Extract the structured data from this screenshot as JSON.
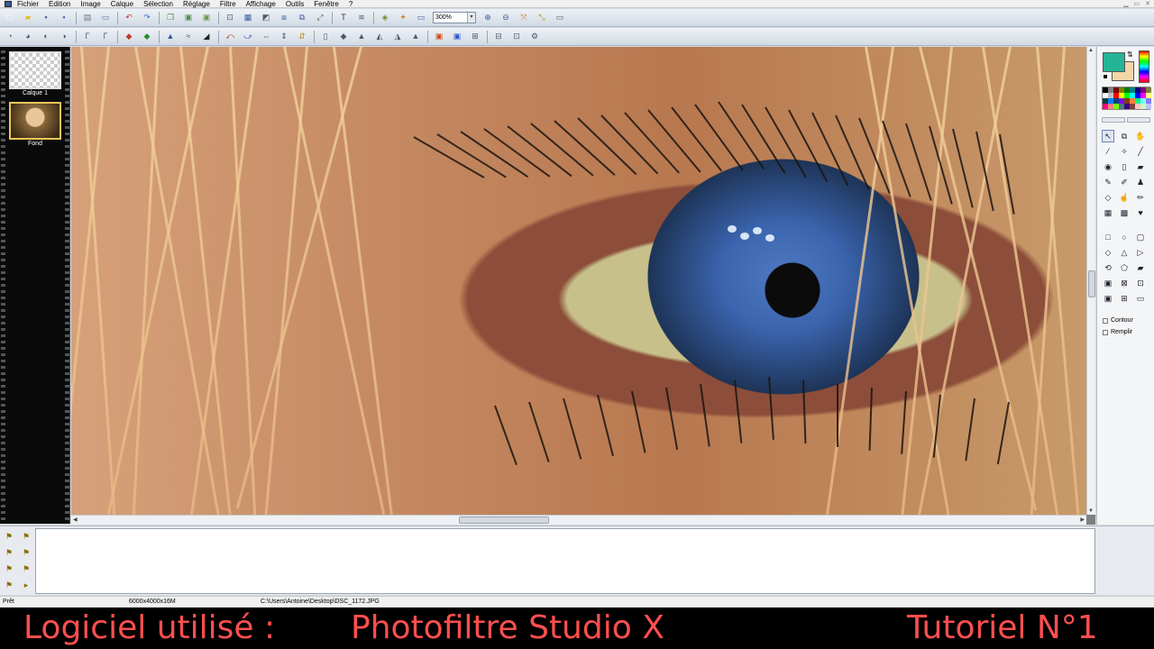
{
  "menubar": {
    "items": [
      "Fichier",
      "Edition",
      "Image",
      "Calque",
      "Sélection",
      "Réglage",
      "Filtre",
      "Affichage",
      "Outils",
      "Fenêtre",
      "?"
    ]
  },
  "toolbar1": {
    "buttons": [
      {
        "icon": "new-file-icon",
        "glyph": "□",
        "color": "#ffffff"
      },
      {
        "icon": "open-folder-icon",
        "glyph": "▰",
        "color": "#e9b93c"
      },
      {
        "icon": "save-icon",
        "glyph": "▪",
        "color": "#3b5f9e"
      },
      {
        "icon": "save-as-icon",
        "glyph": "▪",
        "color": "#4c6fae"
      },
      {
        "icon": "print-icon",
        "glyph": "▤",
        "color": "#6a7480"
      },
      {
        "icon": "scan-icon",
        "glyph": "▭",
        "color": "#5a6fa6"
      },
      {
        "icon": "undo-icon",
        "glyph": "↶",
        "color": "#c0392b"
      },
      {
        "icon": "redo-icon",
        "glyph": "↷",
        "color": "#3a6fc4"
      },
      {
        "icon": "copy-icon",
        "glyph": "❐",
        "color": "#4a8d4a"
      },
      {
        "icon": "paste-icon",
        "glyph": "▣",
        "color": "#4a8d4a"
      },
      {
        "icon": "paste-new-icon",
        "glyph": "▣",
        "color": "#6a9d4a"
      },
      {
        "icon": "crop-icon",
        "glyph": "⊡",
        "color": "#505a66"
      },
      {
        "icon": "select-all-icon",
        "glyph": "▦",
        "color": "#3a5a9e"
      },
      {
        "icon": "invert-selection-icon",
        "glyph": "◩",
        "color": "#505a66"
      },
      {
        "icon": "image-size-icon",
        "glyph": "⧈",
        "color": "#3a5a9e"
      },
      {
        "icon": "canvas-size-icon",
        "glyph": "⧉",
        "color": "#3a5a9e"
      },
      {
        "icon": "transform-icon",
        "glyph": "⤢",
        "color": "#505a66"
      },
      {
        "icon": "text-icon",
        "glyph": "T",
        "color": "#333333"
      },
      {
        "icon": "warp-icon",
        "glyph": "≋",
        "color": "#505a66"
      },
      {
        "icon": "layer-icon",
        "glyph": "◈",
        "color": "#6a8d2a"
      },
      {
        "icon": "effects-icon",
        "glyph": "✦",
        "color": "#d08a1a"
      },
      {
        "icon": "window-icon",
        "glyph": "▭",
        "color": "#3a5a9e"
      }
    ],
    "zoom_value": "300%",
    "zoom_buttons": [
      {
        "icon": "zoom-in-icon",
        "glyph": "⊕",
        "color": "#3a5a9e"
      },
      {
        "icon": "zoom-out-icon",
        "glyph": "⊖",
        "color": "#3a5a9e"
      },
      {
        "icon": "fit-window-icon",
        "glyph": "⤧",
        "color": "#c08a1a"
      },
      {
        "icon": "actual-size-icon",
        "glyph": "⤡",
        "color": "#c08a1a"
      },
      {
        "icon": "fullscreen-icon",
        "glyph": "▭",
        "color": "#505a66"
      }
    ]
  },
  "toolbar2": {
    "buttons": [
      {
        "icon": "auto-level-icon",
        "glyph": "◔",
        "color": "#505a66"
      },
      {
        "icon": "auto-contrast-icon",
        "glyph": "◕",
        "color": "#505a66"
      },
      {
        "icon": "brightness-minus-icon",
        "glyph": "◐",
        "color": "#505a66"
      },
      {
        "icon": "brightness-plus-icon",
        "glyph": "◑",
        "color": "#505a66"
      },
      {
        "icon": "contrast-minus-icon",
        "glyph": "Γ",
        "color": "#505a66"
      },
      {
        "icon": "contrast-plus-icon",
        "glyph": "Γ",
        "color": "#505a66"
      },
      {
        "icon": "saturation-minus-icon",
        "glyph": "◆",
        "color": "#c0392b"
      },
      {
        "icon": "saturation-plus-icon",
        "glyph": "◆",
        "color": "#2a8d2a"
      },
      {
        "icon": "grayscale-icon",
        "glyph": "▲",
        "color": "#3a5a9e"
      },
      {
        "icon": "dust-icon",
        "glyph": "≈",
        "color": "#505a66"
      },
      {
        "icon": "sharpen-icon",
        "glyph": "◢",
        "color": "#222222"
      },
      {
        "icon": "rotate-left-icon",
        "glyph": "⤺",
        "color": "#c0392b"
      },
      {
        "icon": "rotate-right-icon",
        "glyph": "⤻",
        "color": "#3a5a9e"
      },
      {
        "icon": "flip-horizontal-icon",
        "glyph": "⇔",
        "color": "#505a66"
      },
      {
        "icon": "flip-vertical-icon",
        "glyph": "⇕",
        "color": "#505a66"
      },
      {
        "icon": "mirror-icon",
        "glyph": "⇵",
        "color": "#c08a1a"
      },
      {
        "icon": "border-icon",
        "glyph": "▯",
        "color": "#505a66"
      },
      {
        "icon": "drop-icon",
        "glyph": "◆",
        "color": "#505a66"
      },
      {
        "icon": "flame-icon",
        "glyph": "▲",
        "color": "#505a66"
      },
      {
        "icon": "blur-icon",
        "glyph": "◭",
        "color": "#505a66"
      },
      {
        "icon": "sharpen-more-icon",
        "glyph": "◮",
        "color": "#505a66"
      },
      {
        "icon": "emboss-icon",
        "glyph": "▲",
        "color": "#505a66"
      },
      {
        "icon": "color-balance-icon",
        "glyph": "▣",
        "color": "#d04a1a"
      },
      {
        "icon": "rgb-icon",
        "glyph": "▣",
        "color": "#2a5ad0"
      },
      {
        "icon": "histogram-icon",
        "glyph": "⊞",
        "color": "#505a66"
      },
      {
        "icon": "gradient-icon",
        "glyph": "⊟",
        "color": "#505a66"
      },
      {
        "icon": "frame-icon",
        "glyph": "⊡",
        "color": "#505a66"
      },
      {
        "icon": "texture-icon",
        "glyph": "⚙",
        "color": "#505a66"
      }
    ]
  },
  "layers": {
    "items": [
      {
        "label": "Calque 1",
        "type": "transparent"
      },
      {
        "label": "Fond",
        "type": "photo"
      }
    ]
  },
  "colors": {
    "foreground": "#26b496",
    "background": "#f4d6a6",
    "palette": [
      "#000000",
      "#808080",
      "#800000",
      "#808000",
      "#008000",
      "#008080",
      "#000080",
      "#800080",
      "#808040",
      "#ffffff",
      "#c0c0c0",
      "#ff0000",
      "#ffff00",
      "#00ff00",
      "#00ffff",
      "#0000ff",
      "#ff00ff",
      "#ffff80",
      "#004040",
      "#0080ff",
      "#004080",
      "#8000ff",
      "#804000",
      "#ff8040",
      "#00ff80",
      "#80ffff",
      "#8080ff",
      "#ff0080",
      "#ff8080",
      "#80ff00",
      "#408080",
      "#400080",
      "#804040",
      "#ffc0c0",
      "#c0ffc0",
      "#c0c0ff"
    ]
  },
  "tools": {
    "main": [
      {
        "icon": "select-arrow-icon",
        "glyph": "↖",
        "active": true
      },
      {
        "icon": "move-layer-icon",
        "glyph": "⧉",
        "active": false
      },
      {
        "icon": "hand-icon",
        "glyph": "✋",
        "active": false
      },
      {
        "icon": "eyedropper-icon",
        "glyph": "⁄",
        "active": false
      },
      {
        "icon": "magic-wand-icon",
        "glyph": "✧",
        "active": false
      },
      {
        "icon": "line-icon",
        "glyph": "╱",
        "active": false
      },
      {
        "icon": "fill-bucket-icon",
        "glyph": "◉",
        "active": false
      },
      {
        "icon": "spray-icon",
        "glyph": "▯",
        "active": false
      },
      {
        "icon": "eraser-icon",
        "glyph": "▰",
        "active": false
      },
      {
        "icon": "brush-icon",
        "glyph": "✎",
        "active": false
      },
      {
        "icon": "art-brush-icon",
        "glyph": "✐",
        "active": false
      },
      {
        "icon": "stamp-icon",
        "glyph": "♟",
        "active": false
      },
      {
        "icon": "blur-drop-icon",
        "glyph": "◇",
        "active": false
      },
      {
        "icon": "smudge-icon",
        "glyph": "☝",
        "active": false
      },
      {
        "icon": "pencil-icon",
        "glyph": "✏",
        "active": false
      },
      {
        "icon": "pattern-icon",
        "glyph": "▦",
        "active": false
      },
      {
        "icon": "clone-icon",
        "glyph": "▩",
        "active": false
      },
      {
        "icon": "red-eye-icon",
        "glyph": "♥",
        "active": false
      }
    ],
    "selection": [
      {
        "icon": "rectangle-select-icon",
        "glyph": "□",
        "active": false
      },
      {
        "icon": "ellipse-select-icon",
        "glyph": "○",
        "active": false
      },
      {
        "icon": "rounded-rect-select-icon",
        "glyph": "▢",
        "active": false
      },
      {
        "icon": "diamond-select-icon",
        "glyph": "◇",
        "active": false
      },
      {
        "icon": "triangle-select-icon",
        "glyph": "△",
        "active": false
      },
      {
        "icon": "right-triangle-select-icon",
        "glyph": "▷",
        "active": false
      },
      {
        "icon": "lasso-icon",
        "glyph": "⟲",
        "active": false
      },
      {
        "icon": "polygon-lasso-icon",
        "glyph": "⬠",
        "active": false
      },
      {
        "icon": "open-selection-icon",
        "glyph": "▰",
        "active": false
      },
      {
        "icon": "selection-a-icon",
        "glyph": "▣",
        "active": false
      },
      {
        "icon": "selection-b-icon",
        "glyph": "⊠",
        "active": false
      },
      {
        "icon": "selection-c-icon",
        "glyph": "⊡",
        "active": false
      },
      {
        "icon": "selection-d-icon",
        "glyph": "▣",
        "active": false
      },
      {
        "icon": "selection-e-icon",
        "glyph": "⊞",
        "active": false
      },
      {
        "icon": "selection-f-icon",
        "glyph": "▭",
        "active": false
      }
    ],
    "options": [
      {
        "label": "Contour"
      },
      {
        "label": "Remplir"
      }
    ]
  },
  "bottom_tools": [
    {
      "icon": "history-a-icon",
      "glyph": "⚑"
    },
    {
      "icon": "history-b-icon",
      "glyph": "⚑"
    },
    {
      "icon": "history-c-icon",
      "glyph": "⚑"
    },
    {
      "icon": "history-d-icon",
      "glyph": "⚑"
    },
    {
      "icon": "history-e-icon",
      "glyph": "⚑"
    },
    {
      "icon": "history-f-icon",
      "glyph": "⚑"
    },
    {
      "icon": "history-g-icon",
      "glyph": "⚑"
    },
    {
      "icon": "play-icon",
      "glyph": "▸"
    }
  ],
  "status": {
    "state": "Prêt",
    "size": "6000x4000x16M",
    "path": "C:\\Users\\Antoine\\Desktop\\DSC_1172.JPG"
  },
  "caption": {
    "left": "Logiciel utilisé :",
    "middle": "Photofiltre Studio X",
    "right": "Tutoriel N°1"
  }
}
